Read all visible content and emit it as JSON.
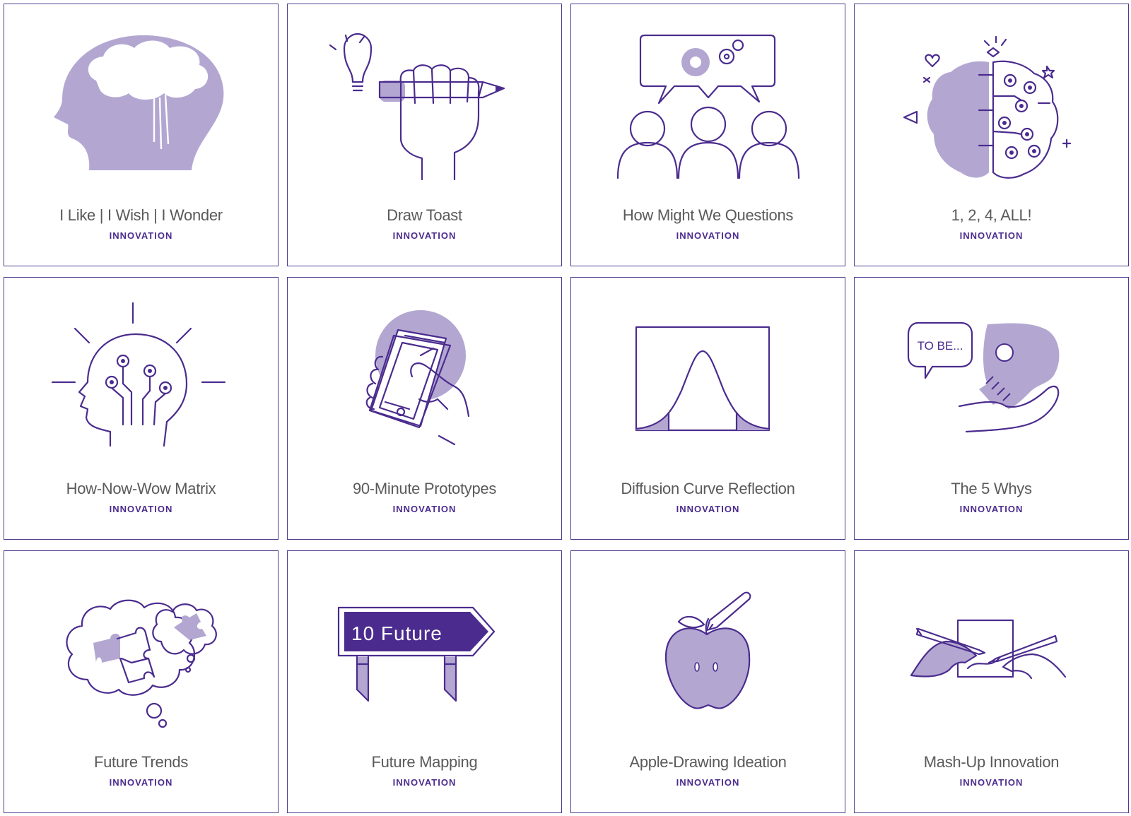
{
  "colors": {
    "accent": "#4b2c8e",
    "illustration_fill": "#b3a7d2",
    "border": "#4e3a8f",
    "title": "#5a5a5a"
  },
  "cards": [
    {
      "title": "I Like | I Wish | I Wonder",
      "category": "INNOVATION",
      "icon": "head-cloud-icon"
    },
    {
      "title": "Draw Toast",
      "category": "INNOVATION",
      "icon": "fist-pencil-lightbulb-icon"
    },
    {
      "title": "How Might We Questions",
      "category": "INNOVATION",
      "icon": "group-gears-speech-icon"
    },
    {
      "title": "1, 2, 4, ALL!",
      "category": "INNOVATION",
      "icon": "brain-circuit-icon"
    },
    {
      "title": "How-Now-Wow Matrix",
      "category": "INNOVATION",
      "icon": "head-circuit-icon"
    },
    {
      "title": "90-Minute Prototypes",
      "category": "INNOVATION",
      "icon": "hand-phone-icon"
    },
    {
      "title": "Diffusion Curve Reflection",
      "category": "INNOVATION",
      "icon": "bell-curve-icon"
    },
    {
      "title": "The 5 Whys",
      "category": "INNOVATION",
      "icon": "skull-hand-icon",
      "speech": "TO BE..."
    },
    {
      "title": "Future Trends",
      "category": "INNOVATION",
      "icon": "thought-puzzle-icon"
    },
    {
      "title": "Future Mapping",
      "category": "INNOVATION",
      "icon": "signpost-icon",
      "sign_text": "10 Future"
    },
    {
      "title": "Apple-Drawing Ideation",
      "category": "INNOVATION",
      "icon": "apple-pencil-icon"
    },
    {
      "title": "Mash-Up Innovation",
      "category": "INNOVATION",
      "icon": "hands-drawing-icon"
    }
  ]
}
